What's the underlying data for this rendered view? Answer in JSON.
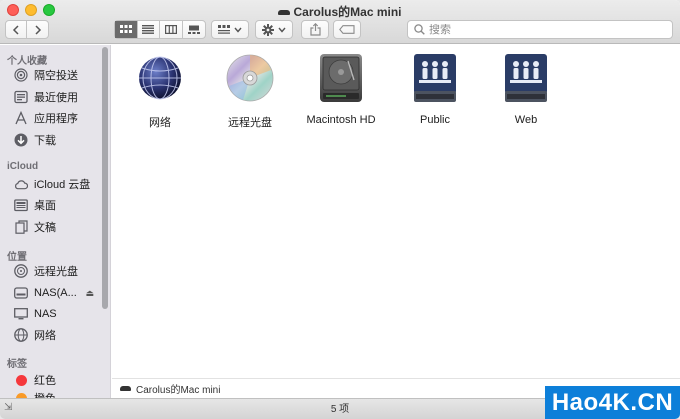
{
  "window": {
    "title": "Carolus的Mac mini"
  },
  "toolbar": {
    "back_icon": "chevron-left-icon",
    "forward_icon": "chevron-right-icon",
    "search_placeholder": "搜索"
  },
  "sidebar": {
    "sections": [
      {
        "title": "个人收藏",
        "items": [
          {
            "label": "隔空投送",
            "icon": "airdrop-icon"
          },
          {
            "label": "最近使用",
            "icon": "recents-icon"
          },
          {
            "label": "应用程序",
            "icon": "applications-icon"
          },
          {
            "label": "下载",
            "icon": "download-icon"
          }
        ]
      },
      {
        "title": "iCloud",
        "items": [
          {
            "label": "iCloud 云盘",
            "icon": "cloud-icon"
          },
          {
            "label": "桌面",
            "icon": "desktop-icon"
          },
          {
            "label": "文稿",
            "icon": "documents-icon"
          }
        ]
      },
      {
        "title": "位置",
        "items": [
          {
            "label": "远程光盘",
            "icon": "disc-icon"
          },
          {
            "label": "NAS(A...",
            "icon": "server-icon"
          },
          {
            "label": "NAS",
            "icon": "monitor-icon"
          },
          {
            "label": "网络",
            "icon": "network-icon"
          }
        ]
      },
      {
        "title": "标签",
        "items": [
          {
            "label": "红色",
            "color": "#f5373c"
          },
          {
            "label": "橙色",
            "color": "#f99a28"
          }
        ]
      }
    ]
  },
  "main": {
    "items": [
      {
        "label": "网络",
        "icon": "network-globe-icon"
      },
      {
        "label": "远程光盘",
        "icon": "optical-disc-icon"
      },
      {
        "label": "Macintosh HD",
        "icon": "hard-drive-icon"
      },
      {
        "label": "Public",
        "icon": "shared-folder-icon"
      },
      {
        "label": "Web",
        "icon": "shared-folder-icon"
      }
    ]
  },
  "pathbar": {
    "label": "Carolus的Mac mini"
  },
  "status": {
    "text": "5 项"
  },
  "watermark": {
    "text": "Hao4K.CN"
  },
  "colors": {
    "close": "#fe5f57",
    "minimize": "#febc2e",
    "maximize": "#28c840",
    "watermark_bg": "#0d7fd9"
  }
}
